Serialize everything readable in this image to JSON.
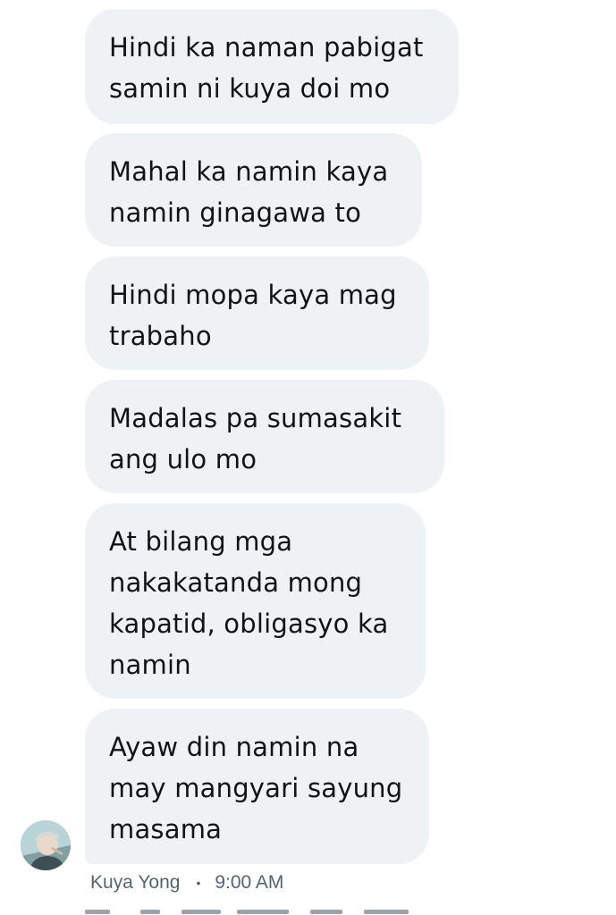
{
  "conversation": {
    "messages": [
      {
        "text_lines": [
          "Hindi ka naman pabigat",
          "samin ni kuya doi mo"
        ]
      },
      {
        "text_lines": [
          "Mahal ka namin kaya",
          "namin ginagawa to"
        ]
      },
      {
        "text_lines": [
          "Hindi mopa kaya mag",
          "trabaho"
        ]
      },
      {
        "text_lines": [
          "Madalas pa sumasakit",
          "ang ulo mo"
        ]
      },
      {
        "text_lines": [
          "At bilang mga",
          "nakakatanda mong",
          "kapatid, obligasyo ka",
          "namin"
        ]
      },
      {
        "text_lines": [
          "Ayaw din namin na",
          "may mangyari sayung",
          "masama"
        ]
      }
    ],
    "sender": {
      "name": "Kuya Yong",
      "separator": "•",
      "timestamp": "9:00 AM",
      "avatar_icon": "user-avatar-photo"
    }
  }
}
